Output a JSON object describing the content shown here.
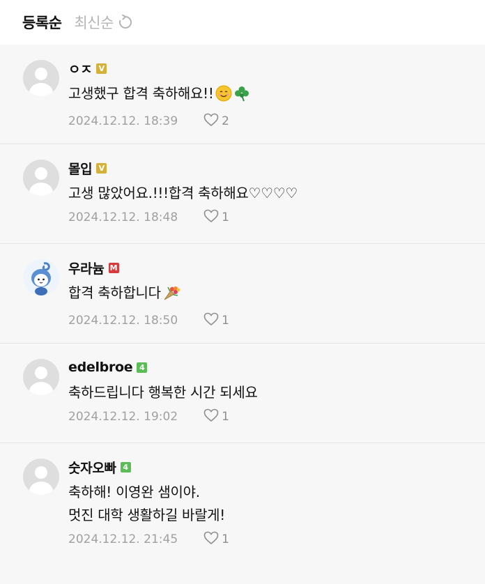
{
  "sort": {
    "active_label": "등록순",
    "inactive_label": "최신순"
  },
  "comments": [
    {
      "nickname": "ㅇㅈ",
      "badge": "V",
      "badge_color": "#d3b13a",
      "text": "고생했구 합격 축하해요!!",
      "emojis": [
        "smiling-face",
        "shamrock"
      ],
      "date": "2024.12.12. 18:39",
      "likes": "2"
    },
    {
      "nickname": "몰입",
      "badge": "V",
      "badge_color": "#d3b13a",
      "text": "고생 많았어요.!!!합격 축하해요♡♡♡♡",
      "emojis": [],
      "date": "2024.12.12. 18:48",
      "likes": "1"
    },
    {
      "nickname": "우라늄",
      "badge": "M",
      "badge_color": "#d73b3b",
      "text": "합격 축하합니다",
      "emojis": [
        "bouquet"
      ],
      "date": "2024.12.12. 18:50",
      "likes": "1"
    },
    {
      "nickname": "edelbroe",
      "badge": "4",
      "badge_color": "#5cbd56",
      "text": "축하드립니다 행복한 시간 되세요",
      "emojis": [],
      "date": "2024.12.12. 19:02",
      "likes": "1"
    },
    {
      "nickname": "숫자오빠",
      "badge": "4",
      "badge_color": "#5cbd56",
      "text": "축하해! 이영완 샘이야.\n멋진 대학 생활하길 바랄게!",
      "emojis": [],
      "date": "2024.12.12. 21:45",
      "likes": "1"
    }
  ]
}
